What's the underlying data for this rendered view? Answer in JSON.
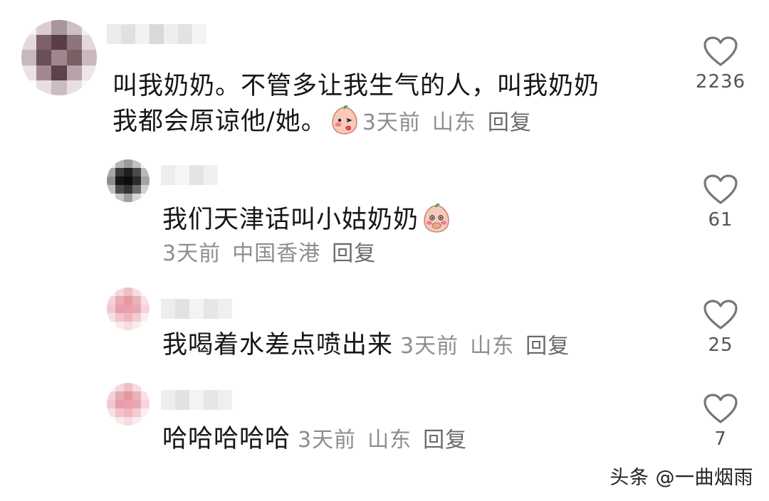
{
  "comments": [
    {
      "text_line1": "叫我奶奶。不管多让我生气的人，叫我奶奶",
      "text_line2": "我都会原谅他/她。",
      "emoji": "blushing-peach-emoji",
      "time": "3天前",
      "location": "山东",
      "reply_label": "回复",
      "likes": "2236"
    }
  ],
  "replies": [
    {
      "text": "我们天津话叫小姑奶奶",
      "emoji": "giggling-peach-emoji",
      "time": "3天前",
      "location": "中国香港",
      "reply_label": "回复",
      "likes": "61"
    },
    {
      "text": "我喝着水差点喷出来",
      "time": "3天前",
      "location": "山东",
      "reply_label": "回复",
      "likes": "25"
    },
    {
      "text": "哈哈哈哈哈",
      "time": "3天前",
      "location": "山东",
      "reply_label": "回复",
      "likes": "7"
    }
  ],
  "icons": {
    "like": "heart-outline-icon"
  },
  "colors": {
    "text": "#161616",
    "meta": "#8e8e8e",
    "heart_stroke": "#777777"
  },
  "watermark": "头条 @一曲烟雨"
}
